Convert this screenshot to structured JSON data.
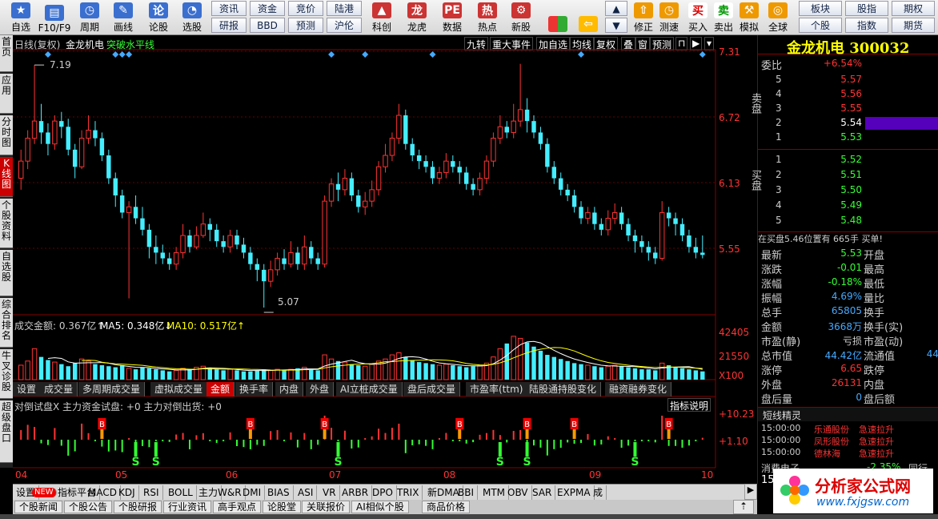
{
  "toolbar": {
    "big_buttons": [
      {
        "label": "自选",
        "icon": "star-icon",
        "color": "#3a6fd0"
      },
      {
        "label": "F10/F9",
        "icon": "document-icon",
        "color": "#3a6fd0"
      },
      {
        "label": "周期",
        "icon": "clock-icon",
        "color": "#3a6fd0"
      },
      {
        "label": "画线",
        "icon": "pen-icon",
        "color": "#3a6fd0"
      },
      {
        "label": "论股",
        "icon": "talk-icon",
        "color": "#3a6fd0"
      },
      {
        "label": "选股",
        "icon": "chart-select-icon",
        "color": "#3a6fd0"
      }
    ],
    "small_buttons": [
      {
        "label": "资讯"
      },
      {
        "label": "资金"
      },
      {
        "label": "竞价"
      },
      {
        "label": "陆港"
      },
      {
        "label": "研报"
      },
      {
        "label": "BBD"
      },
      {
        "label": "预测"
      },
      {
        "label": "沪伦"
      }
    ],
    "mid_buttons": [
      {
        "label": "科创",
        "icon": "chart-icon"
      },
      {
        "label": "龙虎",
        "icon": "dragon-icon"
      },
      {
        "label": "数据",
        "icon": "pe-icon"
      },
      {
        "label": "热点",
        "icon": "hot-icon"
      },
      {
        "label": "新股",
        "icon": "gear-icon"
      }
    ],
    "right_buttons": [
      {
        "label": "修正",
        "icon": "up-arrow-icon"
      },
      {
        "label": "测速",
        "icon": "clock-icon"
      },
      {
        "label": "买入",
        "icon": "buy-icon"
      },
      {
        "label": "卖出",
        "icon": "sell-icon"
      },
      {
        "label": "模拟",
        "icon": "hammer-icon"
      },
      {
        "label": "全球",
        "icon": "globe-icon"
      }
    ],
    "right_small": [
      {
        "label": "板块"
      },
      {
        "label": "股指"
      },
      {
        "label": "期权"
      },
      {
        "label": "个股"
      },
      {
        "label": "指数"
      },
      {
        "label": "期货"
      }
    ]
  },
  "left_tabs": [
    "首页",
    "应用",
    "分时图",
    "K线图",
    "个股资料",
    "自选股",
    "综合排名",
    "牛叉诊股",
    "超级盘口"
  ],
  "chart_header": {
    "period": "日线(复权)",
    "name": "金龙机电",
    "signal": "突破水平线",
    "buttons": [
      "九转",
      "重大事件",
      "加自选",
      "均线",
      "复权",
      "叠",
      "窗",
      "预测"
    ]
  },
  "price_axis": [
    "7.31",
    "6.72",
    "6.13",
    "5.55"
  ],
  "annotations": {
    "high": "7.19",
    "low": "5.07"
  },
  "volume_header": {
    "label": "成交金额: 0.367亿↑",
    "ma5": "MA5: 0.348亿↓",
    "ma10": "MA10: 0.517亿↑"
  },
  "volume_axis": [
    "42405",
    "21550",
    "X100"
  ],
  "sub_tabs": [
    "设置",
    "成交量",
    "多周期成交量",
    "虚拟成交量",
    "金额",
    "换手率",
    "内盘",
    "外盘",
    "AI立桩成交量",
    "盘后成交量",
    "市盈率(ttm)",
    "陆股通持股变化",
    "融资融券变化"
  ],
  "indicator_header": {
    "text": "对倒试盘X 主力资金试盘: +0 主力对倒出货: +0",
    "help": "指标说明"
  },
  "indicator_axis": [
    "+10.23",
    "+1.10"
  ],
  "date_labels": [
    "04",
    "05",
    "06",
    "07",
    "08",
    "09",
    "10"
  ],
  "bottom_tabs": [
    "设置",
    "NEW",
    "指标平台",
    "MACD",
    "KDJ",
    "RSI",
    "BOLL",
    "主力",
    "W&R",
    "DMI",
    "BIAS",
    "ASI",
    "VR",
    "ARBR",
    "DPO",
    "TRIX",
    "新DMA",
    "BBI",
    "MTM",
    "OBV",
    "SAR",
    "EXPMA",
    "成"
  ],
  "news_tabs": [
    "个股新闻",
    "个股公告",
    "个股研报",
    "行业资讯",
    "高手观点",
    "论股堂",
    "关联报价",
    "AI相似个股",
    "商品价格"
  ],
  "quote": {
    "title": "金龙机电 300032",
    "weibi_label": "委比",
    "weibi_value": "+6.54%",
    "sell_label": "卖盘",
    "buy_label": "买盘",
    "sell": [
      {
        "level": "5",
        "price": "5.57"
      },
      {
        "level": "4",
        "price": "5.56"
      },
      {
        "level": "3",
        "price": "5.55"
      },
      {
        "level": "2",
        "price": "5.54"
      },
      {
        "level": "1",
        "price": "5.53"
      }
    ],
    "buy": [
      {
        "level": "1",
        "price": "5.52"
      },
      {
        "level": "2",
        "price": "5.51"
      },
      {
        "level": "3",
        "price": "5.50"
      },
      {
        "level": "4",
        "price": "5.49"
      },
      {
        "level": "5",
        "price": "5.48"
      }
    ],
    "ticker": "在买盘5.46位置有 665手 买单!",
    "stats": [
      {
        "label": "最新",
        "value": "5.53",
        "label2": "开盘",
        "color": "#3f3"
      },
      {
        "label": "涨跌",
        "value": "-0.01",
        "label2": "最高",
        "color": "#3f3"
      },
      {
        "label": "涨幅",
        "value": "-0.18%",
        "label2": "最低",
        "color": "#3f3"
      },
      {
        "label": "振幅",
        "value": "4.69%",
        "label2": "量比",
        "color": "#4af"
      },
      {
        "label": "总手",
        "value": "65805",
        "label2": "换手",
        "color": "#4af"
      },
      {
        "label": "金额",
        "value": "3668万",
        "label2": "换手(实)",
        "color": "#4af"
      },
      {
        "label": "市盈(静)",
        "value": "亏损",
        "label2": "市盈(动)",
        "color": "#ccc"
      },
      {
        "label": "总市值",
        "value": "44.42亿",
        "label2": "流通值",
        "color": "#4af"
      },
      {
        "label": "涨停",
        "value": "6.65",
        "label2": "跌停",
        "color": "#f33"
      },
      {
        "label": "外盘",
        "value": "26131",
        "label2": "内盘",
        "color": "#f33"
      },
      {
        "label": "盘后量",
        "value": "0",
        "label2": "盘后额",
        "color": "#4af"
      }
    ],
    "partial_value": "44",
    "news_title": "短线精灵",
    "news": [
      {
        "time": "15:00:00",
        "stock": "乐通股份",
        "event": "急速拉升"
      },
      {
        "time": "15:00:00",
        "stock": "凤形股份",
        "event": "急速拉升"
      },
      {
        "time": "15:00:00",
        "stock": "德林海",
        "event": "急速拉升"
      }
    ],
    "sector": {
      "name": "消费电子",
      "change": "-2.35%",
      "extra": "同行"
    },
    "sector2": "15"
  },
  "watermark": {
    "name": "分析家公式网",
    "url": "www.fxjgsw.com"
  },
  "chart_data": {
    "type": "candlestick",
    "ylim": [
      5.0,
      7.31
    ],
    "candles": [
      [
        6.2,
        6.35,
        6.45,
        6.1
      ],
      [
        6.35,
        6.55,
        6.62,
        6.28
      ],
      [
        6.55,
        6.7,
        7.19,
        6.5
      ],
      [
        6.7,
        6.6,
        6.85,
        6.5
      ],
      [
        6.6,
        6.5,
        6.68,
        6.4
      ],
      [
        6.5,
        6.7,
        6.75,
        6.45
      ],
      [
        6.7,
        6.65,
        6.78,
        6.55
      ],
      [
        6.65,
        6.45,
        6.72,
        6.4
      ],
      [
        6.45,
        6.3,
        6.5,
        6.2
      ],
      [
        6.3,
        6.55,
        6.62,
        6.28
      ],
      [
        6.55,
        6.62,
        6.75,
        6.5
      ],
      [
        6.62,
        6.55,
        6.7,
        6.48
      ],
      [
        6.55,
        6.4,
        6.6,
        6.35
      ],
      [
        6.4,
        6.2,
        6.45,
        6.15
      ],
      [
        6.2,
        6.05,
        6.25,
        5.95
      ],
      [
        6.05,
        5.9,
        6.1,
        5.85
      ],
      [
        5.9,
        5.95,
        6.0,
        5.15
      ],
      [
        5.95,
        5.85,
        6.05,
        5.8
      ],
      [
        5.85,
        5.75,
        5.95,
        5.7
      ],
      [
        5.75,
        5.6,
        5.8,
        5.5
      ],
      [
        5.6,
        5.55,
        5.7,
        5.45
      ],
      [
        5.55,
        5.5,
        5.62,
        5.45
      ],
      [
        5.5,
        5.45,
        5.55,
        5.4
      ],
      [
        5.45,
        5.55,
        5.6,
        5.4
      ],
      [
        5.55,
        5.7,
        5.8,
        5.5
      ],
      [
        5.7,
        5.6,
        5.75,
        5.55
      ],
      [
        5.6,
        5.7,
        5.78,
        5.58
      ],
      [
        5.7,
        5.8,
        5.9,
        5.68
      ],
      [
        5.8,
        5.75,
        5.85,
        5.65
      ],
      [
        5.75,
        5.65,
        5.8,
        5.6
      ],
      [
        5.65,
        5.6,
        5.7,
        5.55
      ],
      [
        5.6,
        5.7,
        5.75,
        5.55
      ],
      [
        5.7,
        5.62,
        5.75,
        5.58
      ],
      [
        5.62,
        5.55,
        5.68,
        5.5
      ],
      [
        5.55,
        5.45,
        5.6,
        5.4
      ],
      [
        5.45,
        5.4,
        5.5,
        5.3
      ],
      [
        5.4,
        5.3,
        5.45,
        5.07
      ],
      [
        5.3,
        5.4,
        5.48,
        5.25
      ],
      [
        5.4,
        5.5,
        5.55,
        5.35
      ],
      [
        5.5,
        5.45,
        5.58,
        5.4
      ],
      [
        5.45,
        5.55,
        5.65,
        5.42
      ],
      [
        5.55,
        5.45,
        5.6,
        5.4
      ],
      [
        5.45,
        5.6,
        5.7,
        5.4
      ],
      [
        5.6,
        5.5,
        5.65,
        5.45
      ],
      [
        5.5,
        5.45,
        5.55,
        5.4
      ],
      [
        5.45,
        6.0,
        6.05,
        5.42
      ],
      [
        6.0,
        6.15,
        6.2,
        5.95
      ],
      [
        6.15,
        6.1,
        6.25,
        6.0
      ],
      [
        6.1,
        6.2,
        6.28,
        6.05
      ],
      [
        6.2,
        6.05,
        6.25,
        6.0
      ],
      [
        6.05,
        5.95,
        6.1,
        5.9
      ],
      [
        5.95,
        6.0,
        6.08,
        5.88
      ],
      [
        6.0,
        6.1,
        6.18,
        5.95
      ],
      [
        6.1,
        6.3,
        6.35,
        6.05
      ],
      [
        6.3,
        6.4,
        6.5,
        6.25
      ],
      [
        6.4,
        6.55,
        6.6,
        6.35
      ],
      [
        6.55,
        6.75,
        6.85,
        6.5
      ],
      [
        6.75,
        6.5,
        6.8,
        6.45
      ],
      [
        6.5,
        6.4,
        6.55,
        6.35
      ],
      [
        6.4,
        6.35,
        6.45,
        6.28
      ],
      [
        6.35,
        6.3,
        6.4,
        6.25
      ],
      [
        6.3,
        6.2,
        6.35,
        6.15
      ],
      [
        6.2,
        6.25,
        6.3,
        6.15
      ],
      [
        6.25,
        6.35,
        6.42,
        6.2
      ],
      [
        6.35,
        6.3,
        6.4,
        6.25
      ],
      [
        6.3,
        6.25,
        6.35,
        6.15
      ],
      [
        6.25,
        6.15,
        6.3,
        6.1
      ],
      [
        6.15,
        6.1,
        6.2,
        6.05
      ],
      [
        6.1,
        6.2,
        6.25,
        6.05
      ],
      [
        6.2,
        6.35,
        6.4,
        6.15
      ],
      [
        6.35,
        6.55,
        6.6,
        6.3
      ],
      [
        6.55,
        6.65,
        6.75,
        6.5
      ],
      [
        6.65,
        6.6,
        6.7,
        6.55
      ],
      [
        6.6,
        6.7,
        6.85,
        6.55
      ],
      [
        6.7,
        6.8,
        7.2,
        6.65
      ],
      [
        6.8,
        6.7,
        6.9,
        6.6
      ],
      [
        6.7,
        6.6,
        6.75,
        6.55
      ],
      [
        6.6,
        6.5,
        6.65,
        6.45
      ],
      [
        6.5,
        6.3,
        6.55,
        6.25
      ],
      [
        6.3,
        6.2,
        6.35,
        6.15
      ],
      [
        6.2,
        6.1,
        6.25,
        6.05
      ],
      [
        6.1,
        6.05,
        6.15,
        6.0
      ],
      [
        6.05,
        5.95,
        6.1,
        5.9
      ],
      [
        5.95,
        5.85,
        6.0,
        5.8
      ],
      [
        5.85,
        5.9,
        5.95,
        5.8
      ],
      [
        5.9,
        5.8,
        5.95,
        5.75
      ],
      [
        5.8,
        5.75,
        5.85,
        5.7
      ],
      [
        5.75,
        5.85,
        5.92,
        5.7
      ],
      [
        5.85,
        5.9,
        5.98,
        5.8
      ],
      [
        5.9,
        5.8,
        5.95,
        5.75
      ],
      [
        5.8,
        5.7,
        5.85,
        5.65
      ],
      [
        5.7,
        5.65,
        5.75,
        5.55
      ],
      [
        5.65,
        5.6,
        5.7,
        5.55
      ],
      [
        5.6,
        5.55,
        5.65,
        5.48
      ],
      [
        5.55,
        5.5,
        5.6,
        5.45
      ],
      [
        5.5,
        5.9,
        6.0,
        5.48
      ],
      [
        5.9,
        5.85,
        5.95,
        5.78
      ],
      [
        5.85,
        5.8,
        5.9,
        5.7
      ],
      [
        5.8,
        5.7,
        5.85,
        5.65
      ],
      [
        5.7,
        5.6,
        5.75,
        5.55
      ],
      [
        5.6,
        5.55,
        5.68,
        5.5
      ],
      [
        5.55,
        5.53,
        5.7,
        5.5
      ]
    ],
    "volumes": [
      14,
      18,
      30,
      22,
      19,
      17,
      15,
      13,
      16,
      20,
      18,
      15,
      14,
      13,
      12,
      14,
      11,
      10,
      12,
      11,
      10,
      9,
      8,
      9,
      11,
      10,
      12,
      13,
      11,
      10,
      9,
      10,
      9,
      8,
      8,
      9,
      10,
      9,
      10,
      9,
      10,
      11,
      12,
      10,
      9,
      24,
      20,
      18,
      17,
      15,
      14,
      13,
      15,
      18,
      20,
      24,
      26,
      22,
      19,
      17,
      16,
      15,
      14,
      15,
      14,
      13,
      12,
      13,
      14,
      16,
      22,
      30,
      35,
      42,
      40,
      36,
      32,
      28,
      24,
      22,
      20,
      18,
      16,
      15,
      14,
      13,
      12,
      13,
      14,
      13,
      12,
      11,
      10,
      10,
      9,
      16,
      14,
      12,
      11,
      10,
      9,
      8
    ],
    "signals": [
      {
        "i": 17,
        "type": "S"
      },
      {
        "i": 20,
        "type": "S"
      },
      {
        "i": 47,
        "type": "S"
      },
      {
        "i": 71,
        "type": "S"
      },
      {
        "i": 75,
        "type": "S"
      },
      {
        "i": 91,
        "type": "S"
      }
    ]
  }
}
